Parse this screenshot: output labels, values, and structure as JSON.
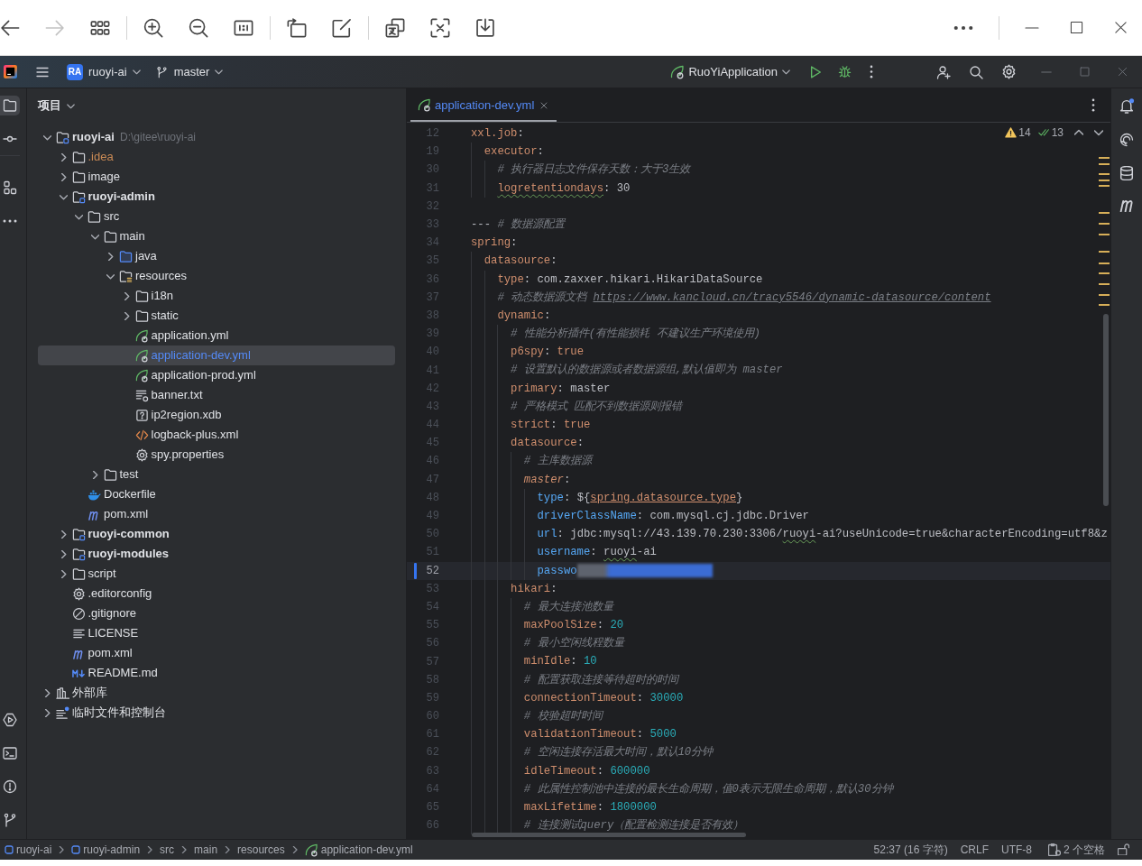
{
  "viewer_toolbar": {
    "back_disabled": false,
    "forward_disabled": true
  },
  "ide_header": {
    "project_badge": "RA",
    "project": "ruoyi-ai",
    "branch": "master",
    "run_configuration": "RuoYiApplication"
  },
  "tool_windows": {
    "project_selected": true,
    "notifications_unread": true
  },
  "project_panel": {
    "title": "项目",
    "tree": [
      {
        "label": "ruoyi-ai",
        "hint": "D:\\gitee\\ruoyi-ai",
        "kind": "module",
        "expanded": true,
        "selected": false,
        "children": [
          {
            "label": ".idea",
            "kind": "folder",
            "color": "#c98a55",
            "expanded": false,
            "selected": false
          },
          {
            "label": "image",
            "kind": "folder",
            "expanded": false,
            "selected": false
          },
          {
            "label": "ruoyi-admin",
            "kind": "module",
            "expanded": true,
            "selected": false,
            "children": [
              {
                "label": "src",
                "kind": "folder",
                "expanded": true,
                "selected": false,
                "children": [
                  {
                    "label": "main",
                    "kind": "folder",
                    "expanded": true,
                    "selected": false,
                    "children": [
                      {
                        "label": "java",
                        "kind": "source_folder",
                        "expanded": false,
                        "selected": false
                      },
                      {
                        "label": "resources",
                        "kind": "resources_folder",
                        "expanded": true,
                        "selected": false,
                        "children": [
                          {
                            "label": "i18n",
                            "kind": "folder",
                            "expanded": false,
                            "selected": false
                          },
                          {
                            "label": "static",
                            "kind": "folder",
                            "expanded": false,
                            "selected": false
                          },
                          {
                            "label": "application.yml",
                            "kind": "spring_config",
                            "selected": false
                          },
                          {
                            "label": "application-dev.yml",
                            "kind": "spring_config",
                            "color": "#548af7",
                            "selected": true
                          },
                          {
                            "label": "application-prod.yml",
                            "kind": "spring_config",
                            "selected": false
                          },
                          {
                            "label": "banner.txt",
                            "kind": "text_file",
                            "selected": false
                          },
                          {
                            "label": "ip2region.xdb",
                            "kind": "binary_file",
                            "selected": false
                          },
                          {
                            "label": "logback-plus.xml",
                            "kind": "xml_file",
                            "selected": false
                          },
                          {
                            "label": "spy.properties",
                            "kind": "properties_file",
                            "selected": false
                          }
                        ]
                      }
                    ]
                  },
                  {
                    "label": "test",
                    "kind": "folder",
                    "expanded": false,
                    "selected": false
                  }
                ]
              },
              {
                "label": "Dockerfile",
                "kind": "docker_file",
                "selected": false
              },
              {
                "label": "pom.xml",
                "kind": "maven_file",
                "selected": false
              }
            ]
          },
          {
            "label": "ruoyi-common",
            "kind": "module",
            "expanded": false,
            "selected": false
          },
          {
            "label": "ruoyi-modules",
            "kind": "module",
            "expanded": false,
            "selected": false
          },
          {
            "label": "script",
            "kind": "folder",
            "expanded": false,
            "selected": false
          },
          {
            "label": ".editorconfig",
            "kind": "properties_file",
            "selected": false
          },
          {
            "label": ".gitignore",
            "kind": "ignore_file",
            "selected": false
          },
          {
            "label": "LICENSE",
            "kind": "license_file",
            "selected": false
          },
          {
            "label": "pom.xml",
            "kind": "maven_file",
            "selected": false
          },
          {
            "label": "README.md",
            "kind": "markdown_file",
            "selected": false
          }
        ]
      },
      {
        "label": "外部库",
        "kind": "libraries",
        "expanded": false,
        "selected": false
      },
      {
        "label": "临时文件和控制台",
        "kind": "scratches",
        "expanded": false,
        "selected": false
      }
    ]
  },
  "editor": {
    "tabs": [
      {
        "label": "application-dev.yml",
        "kind": "spring_config",
        "color": "#548af7",
        "selected": true
      }
    ],
    "inspections": [
      {
        "kind": "warning",
        "count": "14"
      },
      {
        "kind": "weak_warning",
        "count": "13"
      }
    ],
    "lines": [
      {
        "number": "12",
        "current": false,
        "modified": false,
        "tokens": [
          {
            "kind": "key",
            "text": "xxl.job",
            "misspelled": false
          },
          {
            "kind": "punct",
            "text": ":",
            "misspelled": false
          }
        ]
      },
      {
        "number": "19",
        "current": false,
        "modified": false,
        "tokens": [
          {
            "kind": "key",
            "text": "  executor",
            "misspelled": false
          },
          {
            "kind": "punct",
            "text": ":",
            "misspelled": false
          }
        ]
      },
      {
        "number": "30",
        "current": false,
        "modified": false,
        "tokens": [
          {
            "kind": "comment",
            "text": "    # 执行器日志文件保存天数：大于3生效",
            "misspelled": false
          }
        ]
      },
      {
        "number": "31",
        "current": false,
        "modified": false,
        "tokens": [
          {
            "kind": "key",
            "text": "    logretentiondays",
            "misspelled": true
          },
          {
            "kind": "punct",
            "text": ":",
            "misspelled": false
          },
          {
            "kind": "plain",
            "text": " 30",
            "misspelled": false
          }
        ]
      },
      {
        "number": "32",
        "current": false,
        "modified": false
      },
      {
        "number": "33",
        "current": false,
        "modified": false,
        "tokens": [
          {
            "kind": "plain",
            "text": "---",
            "misspelled": false
          },
          {
            "kind": "comment",
            "text": " # 数据源配置",
            "misspelled": false
          }
        ]
      },
      {
        "number": "34",
        "current": false,
        "modified": false,
        "tokens": [
          {
            "kind": "key",
            "text": "spring",
            "misspelled": false
          },
          {
            "kind": "punct",
            "text": ":",
            "misspelled": false
          }
        ]
      },
      {
        "number": "35",
        "current": false,
        "modified": false,
        "tokens": [
          {
            "kind": "key",
            "text": "  datasource",
            "misspelled": false
          },
          {
            "kind": "punct",
            "text": ":",
            "misspelled": false
          }
        ]
      },
      {
        "number": "36",
        "current": false,
        "modified": false,
        "tokens": [
          {
            "kind": "key",
            "text": "    type",
            "misspelled": false
          },
          {
            "kind": "punct",
            "text": ":",
            "misspelled": false
          },
          {
            "kind": "plain",
            "text": " com.zaxxer.hikari.HikariDataSource",
            "misspelled": false
          }
        ]
      },
      {
        "number": "37",
        "current": false,
        "modified": false,
        "tokens": [
          {
            "kind": "comment",
            "text": "    # 动态数据源文档 ",
            "misspelled": false
          },
          {
            "kind": "link",
            "text": "https://www.kancloud.cn/tracy5546/dynamic-datasource/content",
            "misspelled": false
          }
        ]
      },
      {
        "number": "38",
        "current": false,
        "modified": false,
        "tokens": [
          {
            "kind": "key",
            "text": "    dynamic",
            "misspelled": false
          },
          {
            "kind": "punct",
            "text": ":",
            "misspelled": false
          }
        ]
      },
      {
        "number": "39",
        "current": false,
        "modified": false,
        "tokens": [
          {
            "kind": "comment",
            "text": "      # 性能分析插件(有性能损耗 不建议生产环境使用)",
            "misspelled": false
          }
        ]
      },
      {
        "number": "40",
        "current": false,
        "modified": false,
        "tokens": [
          {
            "kind": "key",
            "text": "      p6spy",
            "misspelled": false
          },
          {
            "kind": "punct",
            "text": ":",
            "misspelled": false
          },
          {
            "kind": "keyword",
            "text": " true",
            "misspelled": false
          }
        ]
      },
      {
        "number": "41",
        "current": false,
        "modified": false,
        "tokens": [
          {
            "kind": "comment",
            "text": "      # 设置默认的数据源或者数据源组,默认值即为 master",
            "misspelled": false
          }
        ]
      },
      {
        "number": "42",
        "current": false,
        "modified": false,
        "tokens": [
          {
            "kind": "key",
            "text": "      primary",
            "misspelled": false
          },
          {
            "kind": "punct",
            "text": ":",
            "misspelled": false
          },
          {
            "kind": "plain",
            "text": " master",
            "misspelled": false
          }
        ]
      },
      {
        "number": "43",
        "current": false,
        "modified": false,
        "tokens": [
          {
            "kind": "comment",
            "text": "      # 严格模式 匹配不到数据源则报错",
            "misspelled": false
          }
        ]
      },
      {
        "number": "44",
        "current": false,
        "modified": false,
        "tokens": [
          {
            "kind": "key",
            "text": "      strict",
            "misspelled": false
          },
          {
            "kind": "punct",
            "text": ":",
            "misspelled": false
          },
          {
            "kind": "keyword",
            "text": " true",
            "misspelled": false
          }
        ]
      },
      {
        "number": "45",
        "current": false,
        "modified": false,
        "tokens": [
          {
            "kind": "key",
            "text": "      datasource",
            "misspelled": false
          },
          {
            "kind": "punct",
            "text": ":",
            "misspelled": false
          }
        ]
      },
      {
        "number": "46",
        "current": false,
        "modified": false,
        "tokens": [
          {
            "kind": "comment",
            "text": "        # 主库数据源",
            "misspelled": false
          }
        ]
      },
      {
        "number": "47",
        "current": false,
        "modified": false,
        "tokens": [
          {
            "kind": "label",
            "text": "        master",
            "misspelled": false
          },
          {
            "kind": "punct",
            "text": ":",
            "misspelled": false
          }
        ]
      },
      {
        "number": "48",
        "current": false,
        "modified": false,
        "tokens": [
          {
            "kind": "prop",
            "text": "          type",
            "misspelled": false
          },
          {
            "kind": "punct",
            "text": ":",
            "misspelled": false
          },
          {
            "kind": "plain",
            "text": " ${",
            "misspelled": false
          },
          {
            "kind": "ref",
            "text": "spring.datasource.type",
            "misspelled": false
          },
          {
            "kind": "plain",
            "text": "}",
            "misspelled": false
          }
        ]
      },
      {
        "number": "49",
        "current": false,
        "modified": false,
        "tokens": [
          {
            "kind": "prop",
            "text": "          driverClassName",
            "misspelled": false
          },
          {
            "kind": "punct",
            "text": ":",
            "misspelled": false
          },
          {
            "kind": "plain",
            "text": " com.mysql.cj.jdbc.Driver",
            "misspelled": false
          }
        ]
      },
      {
        "number": "50",
        "current": false,
        "modified": false,
        "tokens": [
          {
            "kind": "prop",
            "text": "          url",
            "misspelled": false
          },
          {
            "kind": "punct",
            "text": ":",
            "misspelled": false
          },
          {
            "kind": "plain",
            "text": " jdbc:mysql://43.139.70.230:3306/",
            "misspelled": false
          },
          {
            "kind": "plain",
            "text": "ruoyi",
            "misspelled": true
          },
          {
            "kind": "plain",
            "text": "-ai?useUnicode=true&characterEncoding=utf8&z",
            "misspelled": false
          }
        ]
      },
      {
        "number": "51",
        "current": false,
        "modified": false,
        "tokens": [
          {
            "kind": "prop",
            "text": "          username",
            "misspelled": false
          },
          {
            "kind": "punct",
            "text": ": ",
            "misspelled": false
          },
          {
            "kind": "plain",
            "text": "ruoyi",
            "misspelled": true
          },
          {
            "kind": "plain",
            "text": "-ai",
            "misspelled": false
          }
        ]
      },
      {
        "number": "52",
        "current": true,
        "modified": true,
        "tokens": [
          {
            "kind": "prop",
            "text": "          passwo",
            "misspelled": false
          },
          {
            "kind": "redacted"
          }
        ]
      },
      {
        "number": "53",
        "current": false,
        "modified": false,
        "tokens": [
          {
            "kind": "key",
            "text": "      hikari",
            "misspelled": false
          },
          {
            "kind": "punct",
            "text": ":",
            "misspelled": false
          }
        ]
      },
      {
        "number": "54",
        "current": false,
        "modified": false,
        "tokens": [
          {
            "kind": "comment",
            "text": "        # 最大连接池数量",
            "misspelled": false
          }
        ]
      },
      {
        "number": "55",
        "current": false,
        "modified": false,
        "tokens": [
          {
            "kind": "key",
            "text": "        maxPoolSize",
            "misspelled": false
          },
          {
            "kind": "punct",
            "text": ":",
            "misspelled": false
          },
          {
            "kind": "number",
            "text": " 20",
            "misspelled": false
          }
        ]
      },
      {
        "number": "56",
        "current": false,
        "modified": false,
        "tokens": [
          {
            "kind": "comment",
            "text": "        # 最小空闲线程数量",
            "misspelled": false
          }
        ]
      },
      {
        "number": "57",
        "current": false,
        "modified": false,
        "tokens": [
          {
            "kind": "key",
            "text": "        minIdle",
            "misspelled": false
          },
          {
            "kind": "punct",
            "text": ":",
            "misspelled": false
          },
          {
            "kind": "number",
            "text": " 10",
            "misspelled": false
          }
        ]
      },
      {
        "number": "58",
        "current": false,
        "modified": false,
        "tokens": [
          {
            "kind": "comment",
            "text": "        # 配置获取连接等待超时的时间",
            "misspelled": false
          }
        ]
      },
      {
        "number": "59",
        "current": false,
        "modified": false,
        "tokens": [
          {
            "kind": "key",
            "text": "        connectionTimeout",
            "misspelled": false
          },
          {
            "kind": "punct",
            "text": ":",
            "misspelled": false
          },
          {
            "kind": "number",
            "text": " 30000",
            "misspelled": false
          }
        ]
      },
      {
        "number": "60",
        "current": false,
        "modified": false,
        "tokens": [
          {
            "kind": "comment",
            "text": "        # 校验超时时间",
            "misspelled": false
          }
        ]
      },
      {
        "number": "61",
        "current": false,
        "modified": false,
        "tokens": [
          {
            "kind": "key",
            "text": "        validationTimeout",
            "misspelled": false
          },
          {
            "kind": "punct",
            "text": ":",
            "misspelled": false
          },
          {
            "kind": "number",
            "text": " 5000",
            "misspelled": false
          }
        ]
      },
      {
        "number": "62",
        "current": false,
        "modified": false,
        "tokens": [
          {
            "kind": "comment",
            "text": "        # 空闲连接存活最大时间，默认10分钟",
            "misspelled": false
          }
        ]
      },
      {
        "number": "63",
        "current": false,
        "modified": false,
        "tokens": [
          {
            "kind": "key",
            "text": "        idleTimeout",
            "misspelled": false
          },
          {
            "kind": "punct",
            "text": ":",
            "misspelled": false
          },
          {
            "kind": "number",
            "text": " 600000",
            "misspelled": false
          }
        ]
      },
      {
        "number": "64",
        "current": false,
        "modified": false,
        "tokens": [
          {
            "kind": "comment",
            "text": "        # 此属性控制池中连接的最长生命周期，值0表示无限生命周期，默认30分钟",
            "misspelled": false
          }
        ]
      },
      {
        "number": "65",
        "current": false,
        "modified": false,
        "tokens": [
          {
            "kind": "key",
            "text": "        maxLifetime",
            "misspelled": false
          },
          {
            "kind": "punct",
            "text": ":",
            "misspelled": false
          },
          {
            "kind": "number",
            "text": " 1800000",
            "misspelled": false
          }
        ]
      },
      {
        "number": "66",
        "current": false,
        "modified": false,
        "tokens": [
          {
            "kind": "comment",
            "text": "        # 连接测试query（配置检测连接是否有效）",
            "misspelled": false
          }
        ]
      }
    ]
  },
  "breadcrumbs": [
    {
      "kind": "module",
      "label": "ruoyi-ai"
    },
    {
      "kind": "module",
      "label": "ruoyi-admin"
    },
    {
      "kind": "folder",
      "label": "src"
    },
    {
      "kind": "folder",
      "label": "main"
    },
    {
      "kind": "folder",
      "label": "resources"
    },
    {
      "kind": "spring_config",
      "label": "application-dev.yml"
    }
  ],
  "status_bar": {
    "position": "52:37 (16 字符)",
    "line_separator": "CRLF",
    "encoding": "UTF-8",
    "indent": "2 个空格"
  }
}
